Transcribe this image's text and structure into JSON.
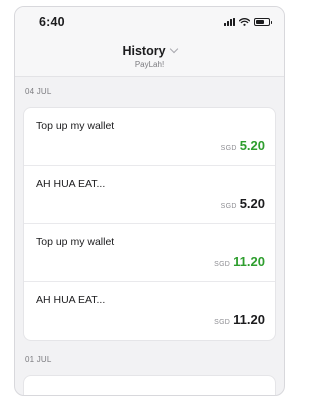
{
  "status": {
    "time": "6:40"
  },
  "header": {
    "title": "History",
    "subtitle": "PayLah!"
  },
  "sections": [
    {
      "date": "04 JUL",
      "transactions": [
        {
          "title": "Top up my wallet",
          "currency": "SGD",
          "amount": "5.20",
          "color": "#2e9e2e"
        },
        {
          "title": "AH HUA EAT...",
          "currency": "SGD",
          "amount": "5.20",
          "color": "#1c1c1e"
        },
        {
          "title": "Top up my wallet",
          "currency": "SGD",
          "amount": "11.20",
          "color": "#2e9e2e"
        },
        {
          "title": "AH HUA EAT...",
          "currency": "SGD",
          "amount": "11.20",
          "color": "#1c1c1e"
        }
      ]
    },
    {
      "date": "01 JUL",
      "transactions": []
    }
  ]
}
